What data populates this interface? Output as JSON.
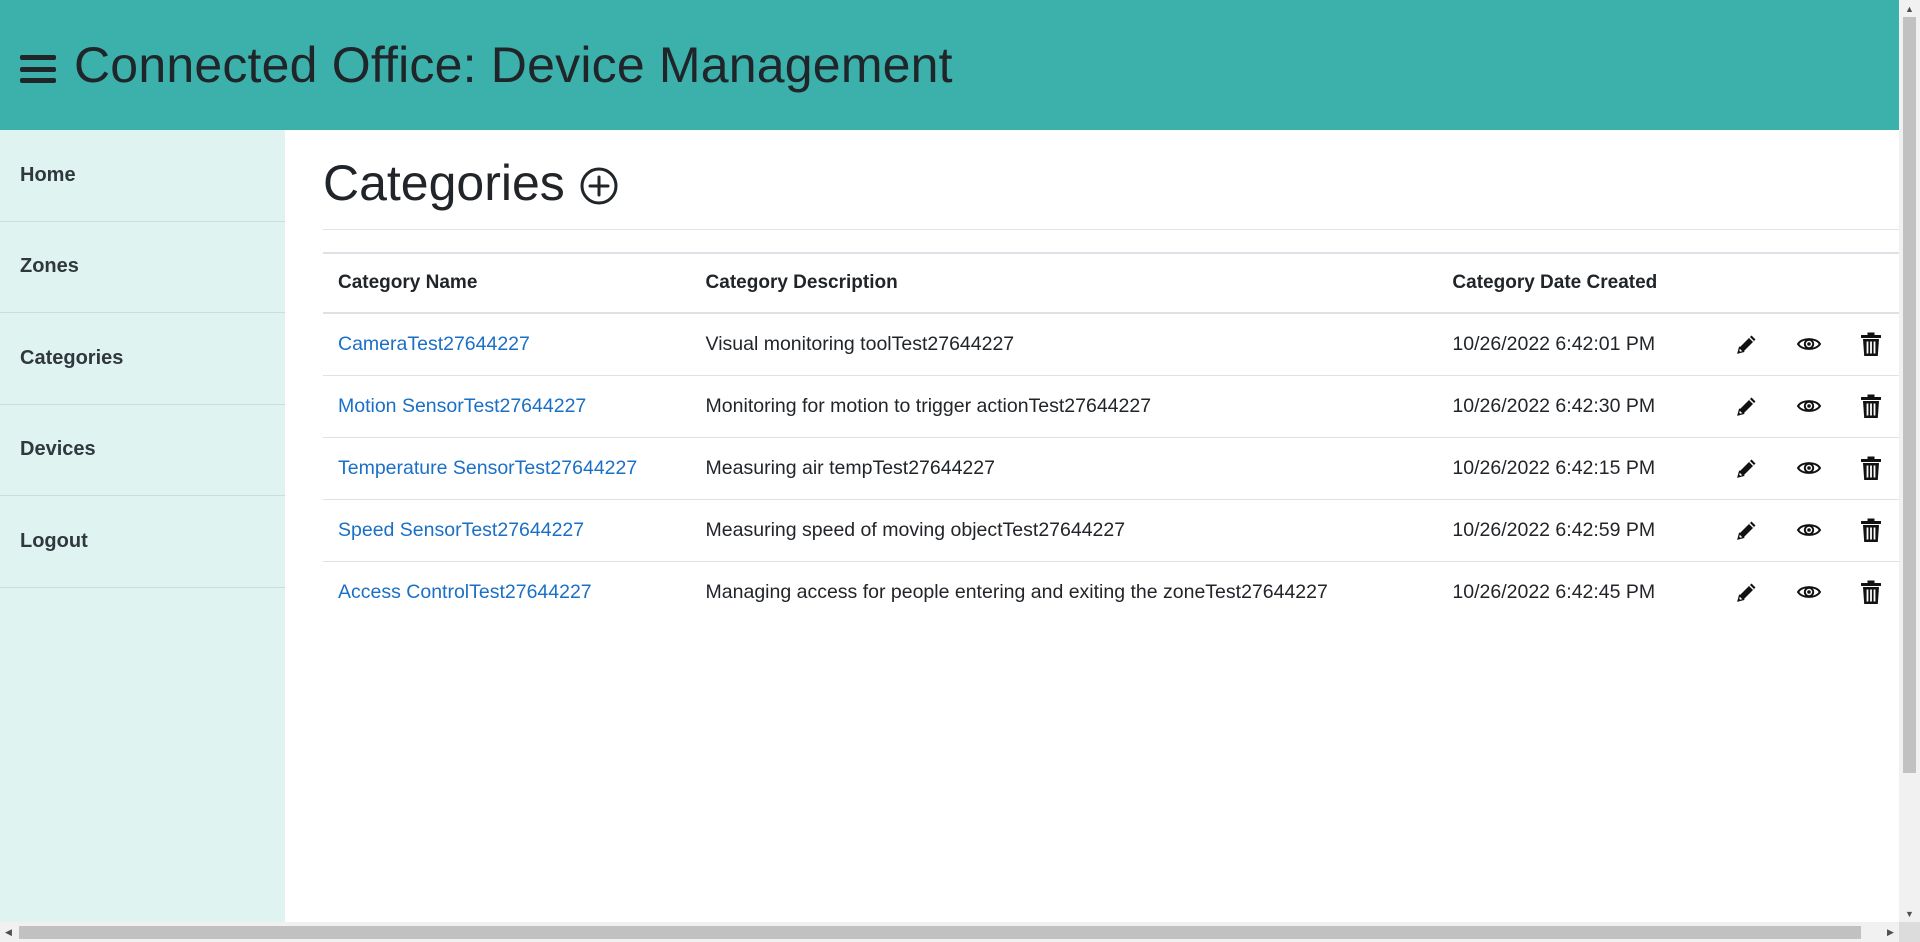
{
  "header": {
    "title": "Connected Office: Device Management",
    "bg_color": "#3cb0ab"
  },
  "sidebar": {
    "bg_color": "#dff4f1",
    "items": [
      {
        "label": "Home"
      },
      {
        "label": "Zones"
      },
      {
        "label": "Categories"
      },
      {
        "label": "Devices"
      },
      {
        "label": "Logout"
      }
    ]
  },
  "main": {
    "title": "Categories",
    "add_icon": "plus-circle-icon",
    "table": {
      "columns": [
        "Category Name",
        "Category Description",
        "Category Date Created"
      ],
      "rows": [
        {
          "name": "CameraTest27644227",
          "description": "Visual monitoring toolTest27644227",
          "date": "10/26/2022 6:42:01 PM"
        },
        {
          "name": "Motion SensorTest27644227",
          "description": "Monitoring for motion to trigger actionTest27644227",
          "date": "10/26/2022 6:42:30 PM"
        },
        {
          "name": "Temperature SensorTest27644227",
          "description": "Measuring air tempTest27644227",
          "date": "10/26/2022 6:42:15 PM"
        },
        {
          "name": "Speed SensorTest27644227",
          "description": "Measuring speed of moving objectTest27644227",
          "date": "10/26/2022 6:42:59 PM"
        },
        {
          "name": "Access ControlTest27644227",
          "description": "Managing access for people entering and exiting the zoneTest27644227",
          "date": "10/26/2022 6:42:45 PM"
        }
      ],
      "row_actions": [
        "pencil-icon",
        "eye-icon",
        "trash-icon"
      ],
      "link_color": "#1a6fc7"
    }
  }
}
